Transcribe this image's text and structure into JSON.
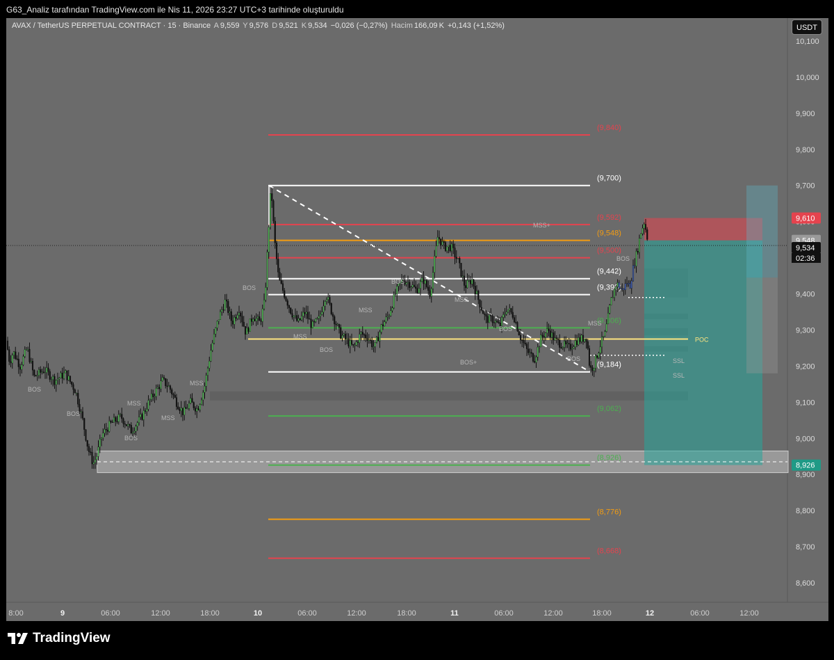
{
  "header": {
    "title": "G63_Analiz tarafından TradingView.com ile Nis 11, 2026 23:27 UTC+3 tarihinde oluşturuldu"
  },
  "legend": {
    "symbol": "AVAX / TetherUS PERPETUAL CONTRACT · 15 · Binance",
    "open_label": "A",
    "open": "9,559",
    "high_label": "Y",
    "high": "9,576",
    "low_label": "D",
    "low": "9,521",
    "close_label": "K",
    "close": "9,534",
    "change": "−0,026 (−0,27%)",
    "volume_label": "Hacim",
    "volume": "166,09",
    "volume_unit": "K",
    "volume_change": "+0,143 (+1,52%)"
  },
  "currency_button": "USDT",
  "branding": {
    "logo_text": "TradingView"
  },
  "chart_data": {
    "type": "candlestick",
    "symbol": "AVAXUSDT.P",
    "timeframe": "15",
    "ylim": [
      8.55,
      10.13
    ],
    "y_ticks": [
      "10,100",
      "10,000",
      "9,900",
      "9,800",
      "9,700",
      "9,600",
      "9,500",
      "9,400",
      "9,300",
      "9,200",
      "9,100",
      "9,000",
      "8,900",
      "8,800",
      "8,700",
      "8,600"
    ],
    "x_ticks": [
      "8:00",
      "9",
      "06:00",
      "12:00",
      "18:00",
      "10",
      "06:00",
      "12:00",
      "18:00",
      "11",
      "06:00",
      "12:00",
      "18:00",
      "12",
      "06:00",
      "12:00"
    ],
    "bold_x_ticks": [
      "9",
      "10",
      "11",
      "12"
    ],
    "price_path": [
      [
        0,
        9.27
      ],
      [
        5,
        9.21
      ],
      [
        10,
        9.24
      ],
      [
        20,
        9.2
      ],
      [
        30,
        9.25
      ],
      [
        40,
        9.17
      ],
      [
        55,
        9.19
      ],
      [
        70,
        9.16
      ],
      [
        85,
        9.18
      ],
      [
        100,
        9.13
      ],
      [
        110,
        9.05
      ],
      [
        118,
        8.97
      ],
      [
        125,
        8.93
      ],
      [
        130,
        8.95
      ],
      [
        138,
        9.01
      ],
      [
        150,
        9.04
      ],
      [
        165,
        9.06
      ],
      [
        180,
        9.02
      ],
      [
        195,
        9.06
      ],
      [
        205,
        9.1
      ],
      [
        215,
        9.13
      ],
      [
        225,
        9.16
      ],
      [
        235,
        9.14
      ],
      [
        245,
        9.1
      ],
      [
        255,
        9.07
      ],
      [
        265,
        9.1
      ],
      [
        275,
        9.08
      ],
      [
        285,
        9.14
      ],
      [
        295,
        9.25
      ],
      [
        305,
        9.33
      ],
      [
        315,
        9.38
      ],
      [
        325,
        9.32
      ],
      [
        335,
        9.36
      ],
      [
        345,
        9.29
      ],
      [
        355,
        9.34
      ],
      [
        365,
        9.32
      ],
      [
        372,
        9.38
      ],
      [
        378,
        9.6
      ],
      [
        381,
        9.7
      ],
      [
        386,
        9.55
      ],
      [
        392,
        9.44
      ],
      [
        400,
        9.4
      ],
      [
        410,
        9.35
      ],
      [
        420,
        9.32
      ],
      [
        430,
        9.35
      ],
      [
        440,
        9.31
      ],
      [
        450,
        9.33
      ],
      [
        460,
        9.4
      ],
      [
        470,
        9.34
      ],
      [
        480,
        9.29
      ],
      [
        490,
        9.27
      ],
      [
        500,
        9.25
      ],
      [
        510,
        9.29
      ],
      [
        520,
        9.28
      ],
      [
        530,
        9.25
      ],
      [
        540,
        9.31
      ],
      [
        550,
        9.34
      ],
      [
        560,
        9.4
      ],
      [
        570,
        9.44
      ],
      [
        580,
        9.43
      ],
      [
        590,
        9.41
      ],
      [
        600,
        9.44
      ],
      [
        610,
        9.4
      ],
      [
        616,
        9.49
      ],
      [
        621,
        9.56
      ],
      [
        630,
        9.53
      ],
      [
        640,
        9.53
      ],
      [
        650,
        9.49
      ],
      [
        660,
        9.42
      ],
      [
        670,
        9.44
      ],
      [
        680,
        9.38
      ],
      [
        690,
        9.33
      ],
      [
        700,
        9.33
      ],
      [
        710,
        9.31
      ],
      [
        720,
        9.36
      ],
      [
        730,
        9.34
      ],
      [
        740,
        9.28
      ],
      [
        750,
        9.24
      ],
      [
        760,
        9.22
      ],
      [
        770,
        9.28
      ],
      [
        780,
        9.3
      ],
      [
        790,
        9.27
      ],
      [
        800,
        9.26
      ],
      [
        810,
        9.25
      ],
      [
        820,
        9.27
      ],
      [
        835,
        9.28
      ],
      [
        840,
        9.19
      ],
      [
        845,
        9.2
      ],
      [
        855,
        9.26
      ],
      [
        862,
        9.29
      ],
      [
        870,
        9.38
      ],
      [
        878,
        9.43
      ],
      [
        886,
        9.41
      ],
      [
        893,
        9.43
      ],
      [
        897,
        9.42
      ],
      [
        902,
        9.47
      ],
      [
        908,
        9.52
      ],
      [
        913,
        9.57
      ],
      [
        918,
        9.6
      ],
      [
        924,
        9.54
      ]
    ],
    "horizontal_levels": [
      {
        "label": "(9,840)",
        "value": 9.84,
        "color": "#e5434e"
      },
      {
        "label": "(9,700)",
        "value": 9.7,
        "color": "#ffffff"
      },
      {
        "label": "(9,592)",
        "value": 9.592,
        "color": "#e5434e"
      },
      {
        "label": "(9,548)",
        "value": 9.548,
        "color": "#f39c12"
      },
      {
        "label": "(9,500)",
        "value": 9.5,
        "color": "#e5434e"
      },
      {
        "label": "(9,442)",
        "value": 9.442,
        "color": "#ffffff"
      },
      {
        "label": "(9,398)",
        "value": 9.398,
        "color": "#ffffff"
      },
      {
        "label": "(9,306)",
        "value": 9.306,
        "color": "#4caf50"
      },
      {
        "label": "(9,184)",
        "value": 9.184,
        "color": "#ffffff"
      },
      {
        "label": "(9,062)",
        "value": 9.062,
        "color": "#4caf50"
      },
      {
        "label": "(8,926)",
        "value": 8.926,
        "color": "#4caf50"
      },
      {
        "label": "(8,776)",
        "value": 8.776,
        "color": "#f39c12"
      },
      {
        "label": "(8,668)",
        "value": 8.668,
        "color": "#e5434e"
      }
    ],
    "poc": {
      "label": "POC",
      "value": 9.275,
      "color": "#ffe680"
    },
    "structure_labels": [
      "BOS",
      "BOS",
      "MSS",
      "MSS",
      "BOS",
      "MSS",
      "BOS",
      "MSS",
      "BOS",
      "MSS",
      "BOS",
      "BOS+",
      "MSS",
      "BOS",
      "MSS+",
      "BOS",
      "MSS",
      "BOS",
      "SSL",
      "SSL"
    ],
    "position": {
      "type": "long",
      "stop": 9.61,
      "entry": 9.548,
      "target": 8.926
    },
    "price_tags": [
      {
        "text": "9,610",
        "value": 9.61,
        "color": "#e5434e"
      },
      {
        "text": "9,548",
        "value": 9.548,
        "color": "#9a9a9a"
      },
      {
        "text": "9,534",
        "value": 9.534,
        "color": "#111111"
      },
      {
        "text": "8,926",
        "value": 8.926,
        "color": "#1f9a86"
      }
    ],
    "countdown": "02:36",
    "colors": {
      "up": "#4caf50",
      "down": "#111111",
      "background": "#6b6b6b",
      "text": "#dddddd"
    }
  }
}
